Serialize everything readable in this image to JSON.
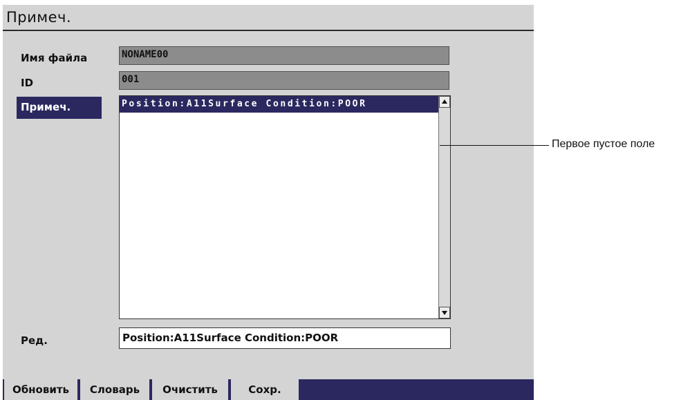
{
  "title": "Примеч.",
  "fields": {
    "filename_label": "Имя файла",
    "filename_value": "NONAME00",
    "id_label": "ID",
    "id_value": "001",
    "notes_label": "Примеч.",
    "notes_lines": [
      "Position:A11Surface Condition:POOR"
    ],
    "edit_label": "Ред.",
    "edit_value": "Position:A11Surface Condition:POOR"
  },
  "softkeys": [
    "Обновить",
    "Словарь",
    "Очистить",
    "Сохр."
  ],
  "callout": "Первое пустое поле",
  "colors": {
    "accent": "#2b2860",
    "panel": "#d4d4d4",
    "field_gray": "#8c8c8c"
  }
}
